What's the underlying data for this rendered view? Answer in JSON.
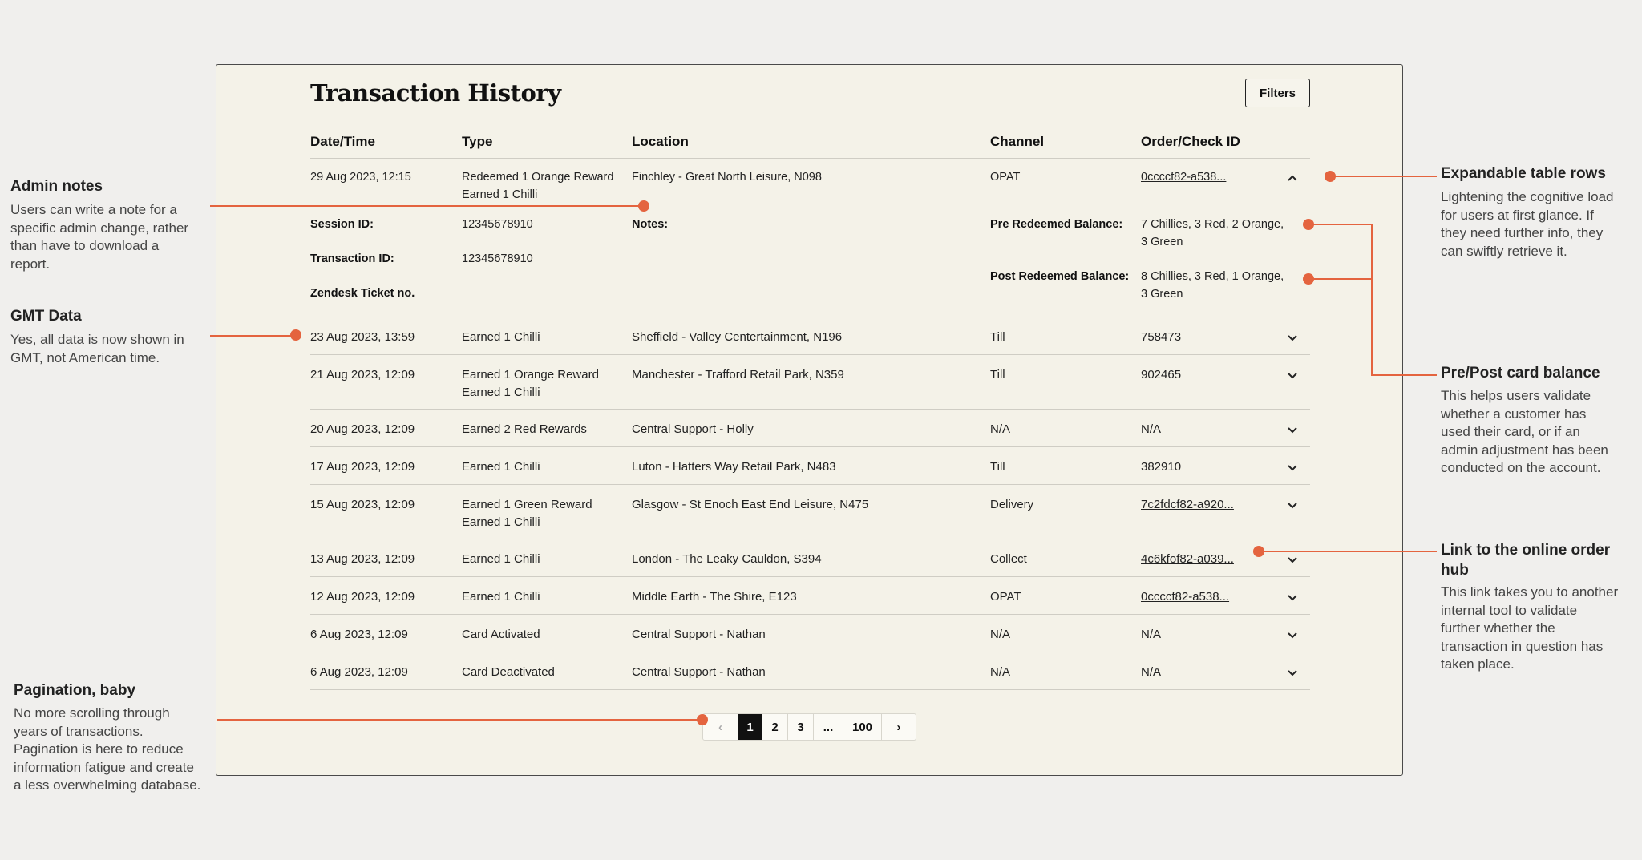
{
  "title": "Transaction History",
  "filters_label": "Filters",
  "columns": [
    "Date/Time",
    "Type",
    "Location",
    "Channel",
    "Order/Check ID"
  ],
  "expanded_row": {
    "date": "29 Aug 2023, 12:15",
    "type_line1": "Redeemed 1 Orange Reward",
    "type_line2": "Earned 1 Chilli",
    "location": "Finchley - Great North Leisure, N098",
    "channel": "OPAT",
    "order_id": "0ccccf82-a538...",
    "session_label": "Session ID:",
    "session_value": "12345678910",
    "transaction_label": "Transaction ID:",
    "transaction_value": "12345678910",
    "zendesk_label": "Zendesk Ticket no.",
    "notes_label": "Notes:",
    "pre_label": "Pre Redeemed Balance:",
    "pre_line1": "7 Chillies, 3 Red, 2 Orange,",
    "pre_line2": "3 Green",
    "post_label": "Post Redeemed Balance:",
    "post_line1": "8 Chillies, 3 Red, 1 Orange,",
    "post_line2": "3 Green"
  },
  "rows": [
    {
      "date": "23 Aug 2023, 13:59",
      "type1": "Earned 1 Chilli",
      "type2": "",
      "location": "Sheffield - Valley Centertainment, N196",
      "channel": "Till",
      "order": "758473"
    },
    {
      "date": "21 Aug 2023, 12:09",
      "type1": "Earned 1 Orange Reward",
      "type2": "Earned 1 Chilli",
      "location": "Manchester - Trafford Retail Park, N359",
      "channel": "Till",
      "order": "902465"
    },
    {
      "date": "20 Aug 2023, 12:09",
      "type1": "Earned 2 Red Rewards",
      "type2": "",
      "location": "Central Support - Holly",
      "channel": "N/A",
      "order": "N/A"
    },
    {
      "date": "17 Aug 2023, 12:09",
      "type1": "Earned 1 Chilli",
      "type2": "",
      "location": "Luton - Hatters Way Retail Park, N483",
      "channel": "Till",
      "order": "382910"
    },
    {
      "date": "15 Aug 2023, 12:09",
      "type1": "Earned 1 Green Reward",
      "type2": "Earned 1 Chilli",
      "location": "Glasgow - St Enoch East End Leisure, N475",
      "channel": "Delivery",
      "order": "7c2fdcf82-a920..."
    },
    {
      "date": "13 Aug 2023, 12:09",
      "type1": "Earned 1 Chilli",
      "type2": "",
      "location": "London -  The Leaky Cauldon, S394",
      "channel": "Collect",
      "order": "4c6kfof82-a039..."
    },
    {
      "date": "12 Aug 2023, 12:09",
      "type1": "Earned 1 Chilli",
      "type2": "",
      "location": "Middle Earth - The Shire, E123",
      "channel": "OPAT",
      "order": "0ccccf82-a538..."
    },
    {
      "date": "6 Aug 2023, 12:09",
      "type1": "Card Activated",
      "type2": "",
      "location": "Central Support - Nathan",
      "channel": "N/A",
      "order": "N/A"
    },
    {
      "date": "6 Aug 2023, 12:09",
      "type1": "Card Deactivated",
      "type2": "",
      "location": "Central Support - Nathan",
      "channel": "N/A",
      "order": "N/A"
    }
  ],
  "pagination": {
    "prev": "‹",
    "pages": [
      "1",
      "2",
      "3",
      "...",
      "100"
    ],
    "next": "›",
    "current": "1"
  },
  "annotations": {
    "admin_title": "Admin notes",
    "admin_text1": "Users can write a note for a",
    "admin_text2": "specific admin change, rather",
    "admin_text3": "than have to download a",
    "admin_text4": "report.",
    "gmt_title": "GMT Data",
    "gmt_text1": "Yes, all data is now shown in",
    "gmt_text2": "GMT, not American time.",
    "pag_title": "Pagination, baby",
    "pag_text1": "No more scrolling through",
    "pag_text2": "years of transactions.",
    "pag_text3": "Pagination is here to reduce",
    "pag_text4": "information fatigue and create",
    "pag_text5": "a less overwhelming database.",
    "exp_title": "Expandable table rows",
    "exp_text1": "Lightening the cognitive load",
    "exp_text2": "for users at first glance. If",
    "exp_text3": "they need further info, they",
    "exp_text4": "can swiftly retrieve it.",
    "bal_title": "Pre/Post card balance",
    "bal_text1": "This helps users validate",
    "bal_text2": "whether a customer has",
    "bal_text3": "used their card, or if an",
    "bal_text4": "admin adjustment has been",
    "bal_text5": "conducted on the account.",
    "link_title1": "Link to the online order",
    "link_title2": "hub",
    "link_text1": "This link takes you to another",
    "link_text2": "internal tool to validate",
    "link_text3": "further whether the",
    "link_text4": "transaction in question has",
    "link_text5": "taken place."
  },
  "colors": {
    "accent": "#e4643f",
    "card_bg": "#f4f2e8",
    "page_bg": "#f0efed"
  }
}
